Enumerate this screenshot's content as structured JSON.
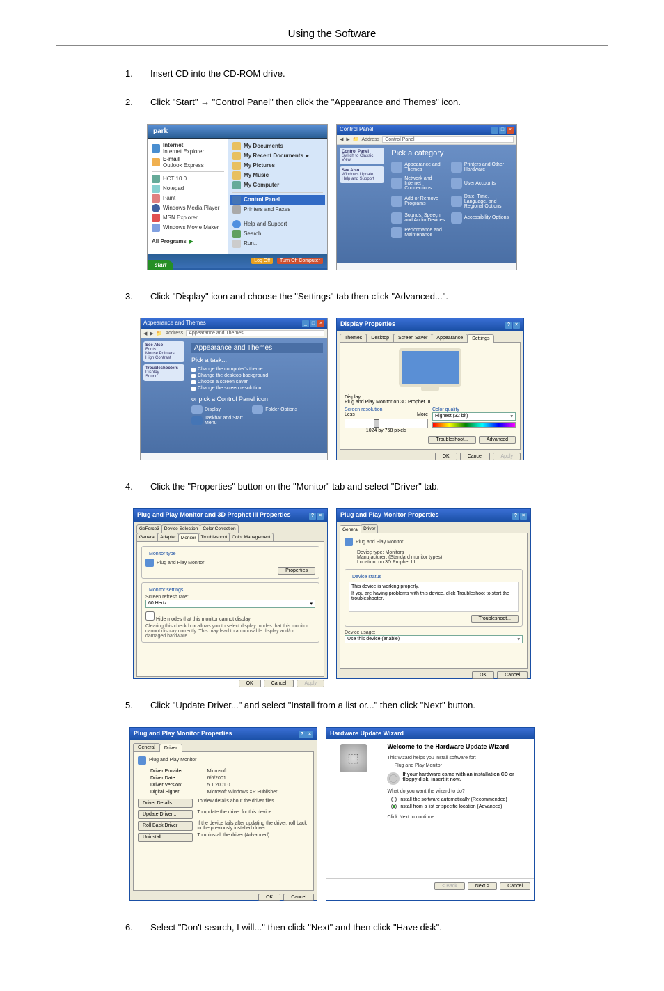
{
  "page_title": "Using the Software",
  "steps": {
    "s1": {
      "num": "1.",
      "text": "Insert CD into the CD-ROM drive."
    },
    "s2": {
      "num": "2.",
      "text": "Click \"Start\" → \"Control Panel\" then click the \"Appearance and Themes\" icon."
    },
    "s3": {
      "num": "3.",
      "text": "Click \"Display\" icon and choose the \"Settings\" tab then click \"Advanced...\"."
    },
    "s4": {
      "num": "4.",
      "text": "Click the \"Properties\" button on the \"Monitor\" tab and select \"Driver\" tab."
    },
    "s5": {
      "num": "5.",
      "text": "Click \"Update Driver...\" and select \"Install from a list or...\" then click \"Next\" button."
    },
    "s6": {
      "num": "6.",
      "text": "Select \"Don't search, I will...\" then click \"Next\" and then click \"Have disk\"."
    }
  },
  "startmenu": {
    "user": "park",
    "left": {
      "internet": "Internet",
      "internet_sub": "Internet Explorer",
      "email": "E-mail",
      "email_sub": "Outlook Express",
      "hct": "HCT 10.0",
      "notepad": "Notepad",
      "paint": "Paint",
      "wmp": "Windows Media Player",
      "msn": "MSN Explorer",
      "mm": "Windows Movie Maker",
      "all": "All Programs"
    },
    "right": {
      "docs": "My Documents",
      "recent": "My Recent Documents",
      "pics": "My Pictures",
      "music": "My Music",
      "comp": "My Computer",
      "cp": "Control Panel",
      "printers": "Printers and Faxes",
      "help": "Help and Support",
      "search": "Search",
      "run": "Run..."
    },
    "footer": {
      "logoff": "Log Off",
      "turnoff": "Turn Off Computer"
    },
    "start": "start"
  },
  "cp_cat": {
    "title": "Control Panel",
    "address": "Control Panel",
    "heading": "Pick a category",
    "left": {
      "switch": "Switch to Classic View",
      "seealso": "See Also",
      "winupdate": "Windows Update",
      "helpsup": "Help and Support"
    },
    "cats": {
      "c1": "Appearance and Themes",
      "c2": "Printers and Other Hardware",
      "c3": "Network and Internet Connections",
      "c4": "User Accounts",
      "c5": "Add or Remove Programs",
      "c6": "Date, Time, Language, and Regional Options",
      "c7": "Sounds, Speech, and Audio Devices",
      "c8": "Accessibility Options",
      "c9": "Performance and Maintenance"
    }
  },
  "appthemes": {
    "title": "Appearance and Themes",
    "hd": "Appearance and Themes",
    "pick_task": "Pick a task...",
    "t1": "Change the computer's theme",
    "t2": "Change the desktop background",
    "t3": "Choose a screen saver",
    "t4": "Change the screen resolution",
    "sub": "or pick a Control Panel icon",
    "i1": "Display",
    "i2": "Folder Options",
    "i3": "Taskbar and Start Menu"
  },
  "dispprops": {
    "title": "Display Properties",
    "tabs": {
      "themes": "Themes",
      "desktop": "Desktop",
      "saver": "Screen Saver",
      "appearance": "Appearance",
      "settings": "Settings"
    },
    "display_lbl": "Display:",
    "display_val": "Plug and Play Monitor on 3D Prophet III",
    "res_lbl": "Screen resolution",
    "res_less": "Less",
    "res_more": "More",
    "res_val": "1024 by 768 pixels",
    "color_lbl": "Color quality",
    "color_val": "Highest (32 bit)",
    "troubleshoot": "Troubleshoot...",
    "advanced": "Advanced",
    "ok": "OK",
    "cancel": "Cancel",
    "apply": "Apply"
  },
  "monprops": {
    "title": "Plug and Play Monitor and 3D Prophet III Properties",
    "gtabs": {
      "gf3": "GeForce3",
      "devsel": "Device Selection",
      "colorcor": "Color Correction",
      "general": "General",
      "adapter": "Adapter",
      "monitor": "Monitor",
      "trouble": "Troubleshoot",
      "colormgmt": "Color Management"
    },
    "mtype_hd": "Monitor type",
    "mtype_val": "Plug and Play Monitor",
    "props_btn": "Properties",
    "mset_hd": "Monitor settings",
    "refresh_lbl": "Screen refresh rate:",
    "refresh_val": "60 Hertz",
    "hide_modes": "Hide modes that this monitor cannot display",
    "hide_desc": "Clearing this check box allows you to select display modes that this monitor cannot display correctly. This may lead to an unusable display and/or damaged hardware.",
    "ok": "OK",
    "cancel": "Cancel",
    "apply": "Apply"
  },
  "pnpprops": {
    "title": "Plug and Play Monitor Properties",
    "tabs": {
      "general": "General",
      "driver": "Driver"
    },
    "name": "Plug and Play Monitor",
    "dtype_lbl": "Device type:",
    "dtype_val": "Monitors",
    "manu_lbl": "Manufacturer:",
    "manu_val": "(Standard monitor types)",
    "loc_lbl": "Location:",
    "loc_val": "on 3D Prophet III",
    "status_hd": "Device status",
    "status_val": "This device is working properly.",
    "status_desc": "If you are having problems with this device, click Troubleshoot to start the troubleshooter.",
    "trouble_btn": "Troubleshoot...",
    "usage_lbl": "Device usage:",
    "usage_val": "Use this device (enable)",
    "ok": "OK",
    "cancel": "Cancel"
  },
  "pnp_driver": {
    "title": "Plug and Play Monitor Properties",
    "name": "Plug and Play Monitor",
    "prov_lbl": "Driver Provider:",
    "prov_val": "Microsoft",
    "date_lbl": "Driver Date:",
    "date_val": "6/6/2001",
    "ver_lbl": "Driver Version:",
    "ver_val": "5.1.2001.0",
    "signer_lbl": "Digital Signer:",
    "signer_val": "Microsoft Windows XP Publisher",
    "details_btn": "Driver Details...",
    "details_desc": "To view details about the driver files.",
    "update_btn": "Update Driver...",
    "update_desc": "To update the driver for this device.",
    "rollback_btn": "Roll Back Driver",
    "rollback_desc": "If the device fails after updating the driver, roll back to the previously installed driver.",
    "uninstall_btn": "Uninstall",
    "uninstall_desc": "To uninstall the driver (Advanced).",
    "ok": "OK",
    "cancel": "Cancel"
  },
  "wizard": {
    "title": "Hardware Update Wizard",
    "welcome": "Welcome to the Hardware Update Wizard",
    "helps": "This wizard helps you install software for:",
    "dev": "Plug and Play Monitor",
    "cd_note": "If your hardware came with an installation CD or floppy disk, insert it now.",
    "what": "What do you want the wizard to do?",
    "r1": "Install the software automatically (Recommended)",
    "r2": "Install from a list or specific location (Advanced)",
    "cont": "Click Next to continue.",
    "back": "< Back",
    "next": "Next >",
    "cancel": "Cancel"
  }
}
